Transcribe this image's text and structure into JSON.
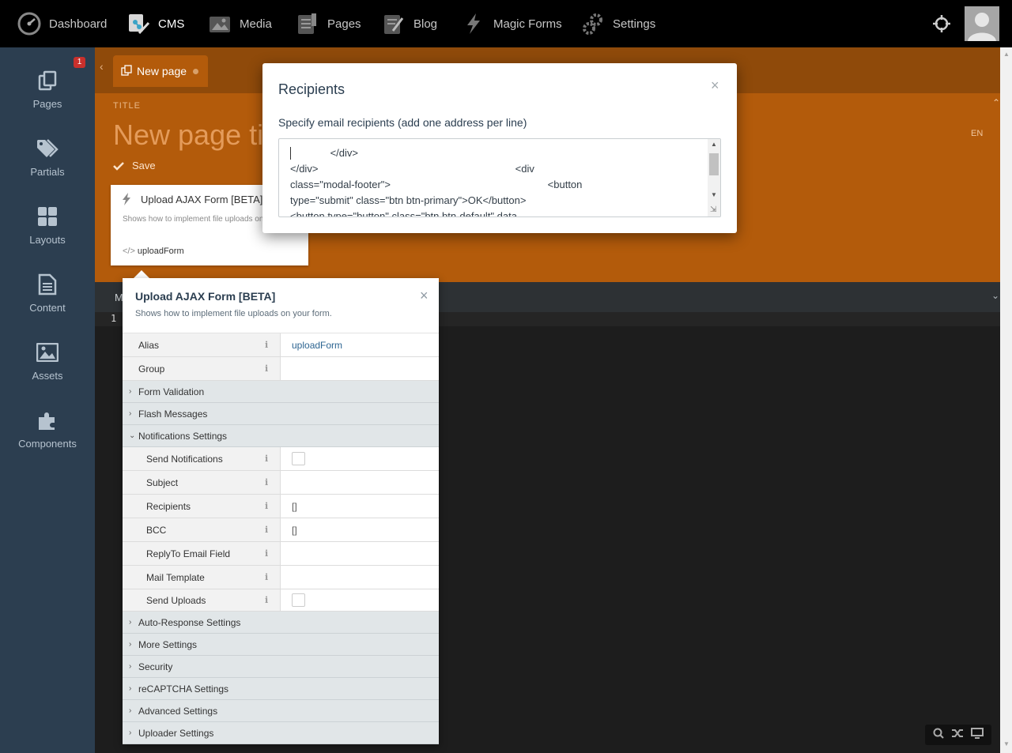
{
  "topnav": {
    "items": [
      {
        "label": "Dashboard",
        "icon": "dashboard-gauge-icon"
      },
      {
        "label": "CMS",
        "icon": "cms-icon",
        "active": true
      },
      {
        "label": "Media",
        "icon": "media-icon"
      },
      {
        "label": "Pages",
        "icon": "pages-icon"
      },
      {
        "label": "Blog",
        "icon": "blog-icon"
      },
      {
        "label": "Magic Forms",
        "icon": "lightning-icon"
      },
      {
        "label": "Settings",
        "icon": "gears-icon"
      }
    ]
  },
  "sidebar": {
    "items": [
      {
        "label": "Pages",
        "icon": "pages-icon",
        "badge": "1"
      },
      {
        "label": "Partials",
        "icon": "tags-icon"
      },
      {
        "label": "Layouts",
        "icon": "layouts-grid-icon"
      },
      {
        "label": "Content",
        "icon": "file-icon"
      },
      {
        "label": "Assets",
        "icon": "image-icon"
      },
      {
        "label": "Components",
        "icon": "puzzle-icon"
      }
    ]
  },
  "editor": {
    "tab_label": "New page",
    "title_label": "TITLE",
    "title_placeholder": "New page tit",
    "save_label": "Save",
    "lang": "EN",
    "markup_label": "M",
    "line_number": "1"
  },
  "component_card": {
    "title": "Upload AJAX Form [BETA]",
    "description": "Shows how to implement file uploads on your form.",
    "alias": "uploadForm"
  },
  "inspector": {
    "title": "Upload AJAX Form [BETA]",
    "description": "Shows how to implement file uploads on your form.",
    "close": "×",
    "info_glyph": "i",
    "properties": {
      "alias": {
        "label": "Alias",
        "value": "uploadForm"
      },
      "group": {
        "label": "Group",
        "value": ""
      },
      "send_notifications": {
        "label": "Send Notifications"
      },
      "subject": {
        "label": "Subject",
        "value": ""
      },
      "recipients": {
        "label": "Recipients",
        "value": "[]"
      },
      "bcc": {
        "label": "BCC",
        "value": "[]"
      },
      "replyto": {
        "label": "ReplyTo Email Field",
        "value": ""
      },
      "mail_template": {
        "label": "Mail Template",
        "value": ""
      },
      "send_uploads": {
        "label": "Send Uploads"
      }
    },
    "groups": {
      "form_validation": "Form Validation",
      "flash_messages": "Flash Messages",
      "notifications": "Notifications Settings",
      "auto_response": "Auto-Response Settings",
      "more": "More Settings",
      "security": "Security",
      "recaptcha": "reCAPTCHA Settings",
      "advanced": "Advanced Settings",
      "uploader": "Uploader Settings"
    }
  },
  "modal": {
    "title": "Recipients",
    "close": "×",
    "label": "Specify email recipients (add one address per line)",
    "text_lines": [
      "              </div>",
      "</div>                                                                     <div",
      "class=\"modal-footer\">                                                       <button",
      "type=\"submit\" class=\"btn btn-primary\">OK</button>",
      "<button type=\"button\" class=\"btn btn-default\" data"
    ]
  },
  "colors": {
    "topbar": "#000000",
    "sidebar": "#2c3e50",
    "accent_orange": "#b35b0b",
    "editor_bg": "#1d1d1d"
  }
}
